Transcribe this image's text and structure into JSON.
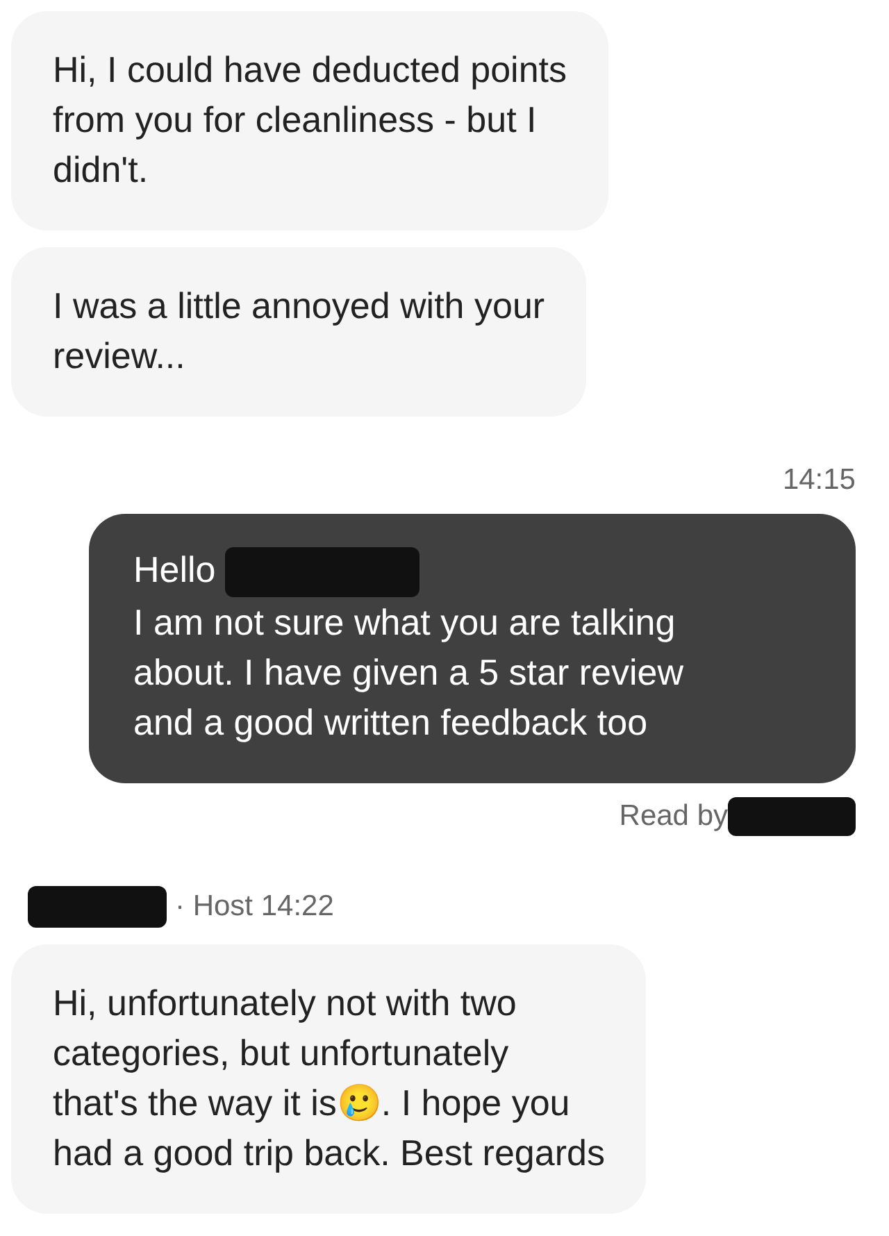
{
  "messages": [
    {
      "kind": "incoming",
      "text": "Hi, I could have deducted points\nfrom you for cleanliness - but I\ndidn't."
    },
    {
      "kind": "incoming",
      "text": "I was a little annoyed with your\nreview..."
    },
    {
      "kind": "timestamp",
      "text": "14:15"
    },
    {
      "kind": "outgoing",
      "greeting": "Hello",
      "greeting_redacted": true,
      "text": "I am not sure what you are talking\nabout. I have given a 5 star review\nand a good written feedback too"
    },
    {
      "kind": "receipt",
      "text": "Read by",
      "redacted": true
    },
    {
      "kind": "sender",
      "text": "· Host 14:22",
      "redacted": true
    },
    {
      "kind": "incoming",
      "text": "Hi, unfortunately not with two\ncategories, but unfortunately\nthat's the way it is🥲. I hope you\nhad a good trip back. Best regards"
    }
  ]
}
